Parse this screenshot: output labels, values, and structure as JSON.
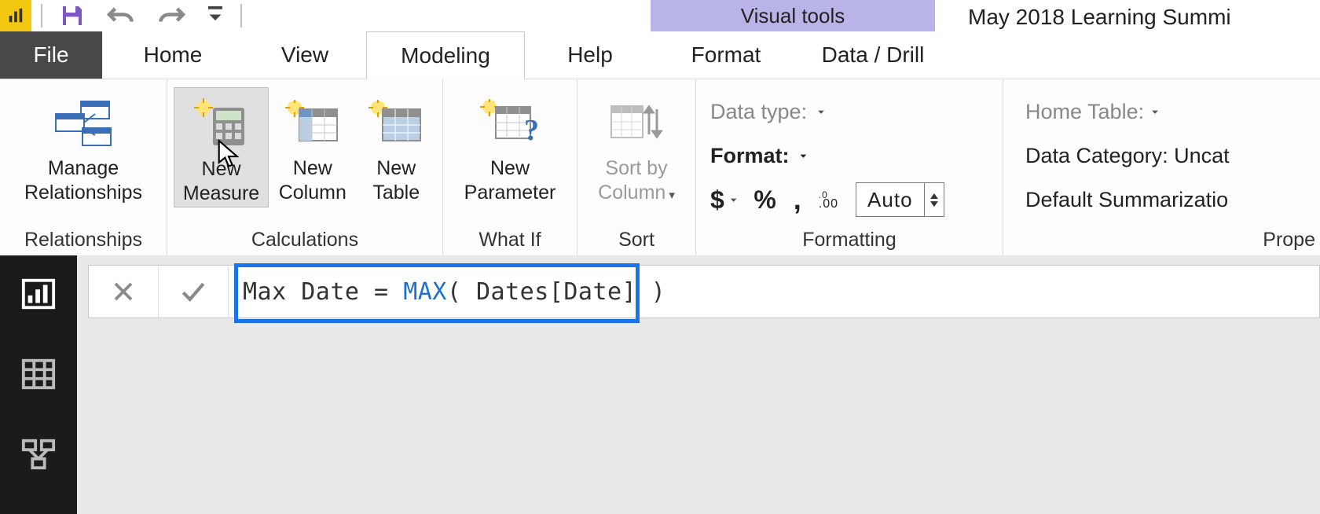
{
  "title": {
    "contextual_tab_label": "Visual tools",
    "filename": "May 2018 Learning Summi"
  },
  "tabs": {
    "file": "File",
    "home": "Home",
    "view": "View",
    "modeling": "Modeling",
    "help": "Help",
    "format": "Format",
    "data_drill": "Data / Drill"
  },
  "ribbon": {
    "relationships": {
      "manage_label": "Manage\nRelationships",
      "group_label": "Relationships"
    },
    "calculations": {
      "new_measure": "New\nMeasure",
      "new_column": "New\nColumn",
      "new_table": "New\nTable",
      "group_label": "Calculations"
    },
    "whatif": {
      "new_parameter": "New\nParameter",
      "group_label": "What If"
    },
    "sort": {
      "sort_by_column": "Sort by\nColumn",
      "group_label": "Sort"
    },
    "formatting": {
      "data_type_label": "Data type:",
      "format_label": "Format:",
      "currency_icon": "$",
      "percent_icon": "%",
      "thousand_icon": ",",
      "decimals_icon": ".00",
      "decimals_spin": "Auto",
      "group_label": "Formatting"
    },
    "properties": {
      "home_table_label": "Home Table:",
      "data_category_label": "Data Category: Uncat",
      "default_summ_label": "Default Summarizatio",
      "group_label": "Prope"
    }
  },
  "formula": {
    "prefix": "Max Date = ",
    "func": "MAX",
    "suffix": "( Dates[Date] )"
  }
}
